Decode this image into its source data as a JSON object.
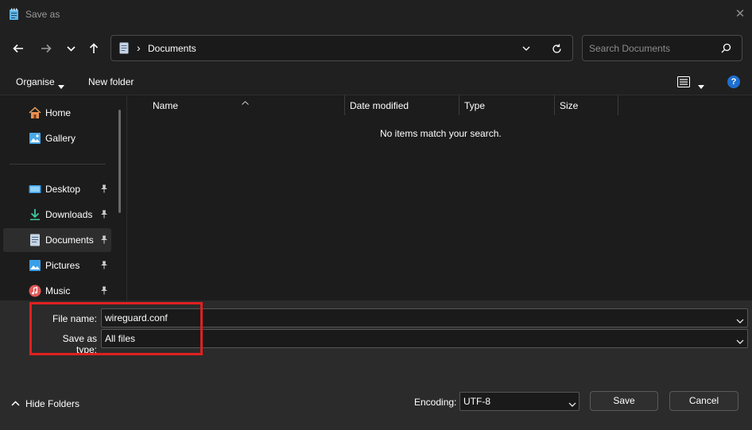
{
  "window": {
    "title": "Save as",
    "close_glyph": "✕"
  },
  "navigation": {
    "back_icon": "arrow-left-icon",
    "forward_icon": "arrow-right-icon",
    "recent_icon": "chevron-down-icon",
    "up_icon": "arrow-up-icon",
    "breadcrumb_separator": "›",
    "current_folder": "Documents",
    "search_placeholder": "Search Documents"
  },
  "toolbar": {
    "organise_label": "Organise",
    "new_folder_label": "New folder",
    "help_glyph": "?"
  },
  "sidebar": {
    "items": [
      {
        "label": "Home",
        "icon": "home-icon",
        "pinned": false
      },
      {
        "label": "Gallery",
        "icon": "gallery-icon",
        "pinned": false
      },
      {
        "label": "Desktop",
        "icon": "desktop-icon",
        "pinned": true
      },
      {
        "label": "Downloads",
        "icon": "downloads-icon",
        "pinned": true
      },
      {
        "label": "Documents",
        "icon": "documents-icon",
        "pinned": true,
        "selected": true
      },
      {
        "label": "Pictures",
        "icon": "pictures-icon",
        "pinned": true
      },
      {
        "label": "Music",
        "icon": "music-icon",
        "pinned": true
      }
    ]
  },
  "filelist": {
    "columns": [
      "Name",
      "Date modified",
      "Type",
      "Size"
    ],
    "empty_message": "No items match your search."
  },
  "form": {
    "file_name_label": "File name:",
    "file_name_value": "wireguard.conf",
    "save_type_label": "Save as type:",
    "save_type_value": "All files",
    "encoding_label": "Encoding:",
    "encoding_value": "UTF-8"
  },
  "footer": {
    "hide_folders_label": "Hide Folders",
    "save_label": "Save",
    "cancel_label": "Cancel"
  },
  "colors": {
    "background": "#1c1c1c",
    "bottom_panel": "#2b2b2b",
    "highlight": "#e02020",
    "help_blue": "#1e6fd0"
  }
}
